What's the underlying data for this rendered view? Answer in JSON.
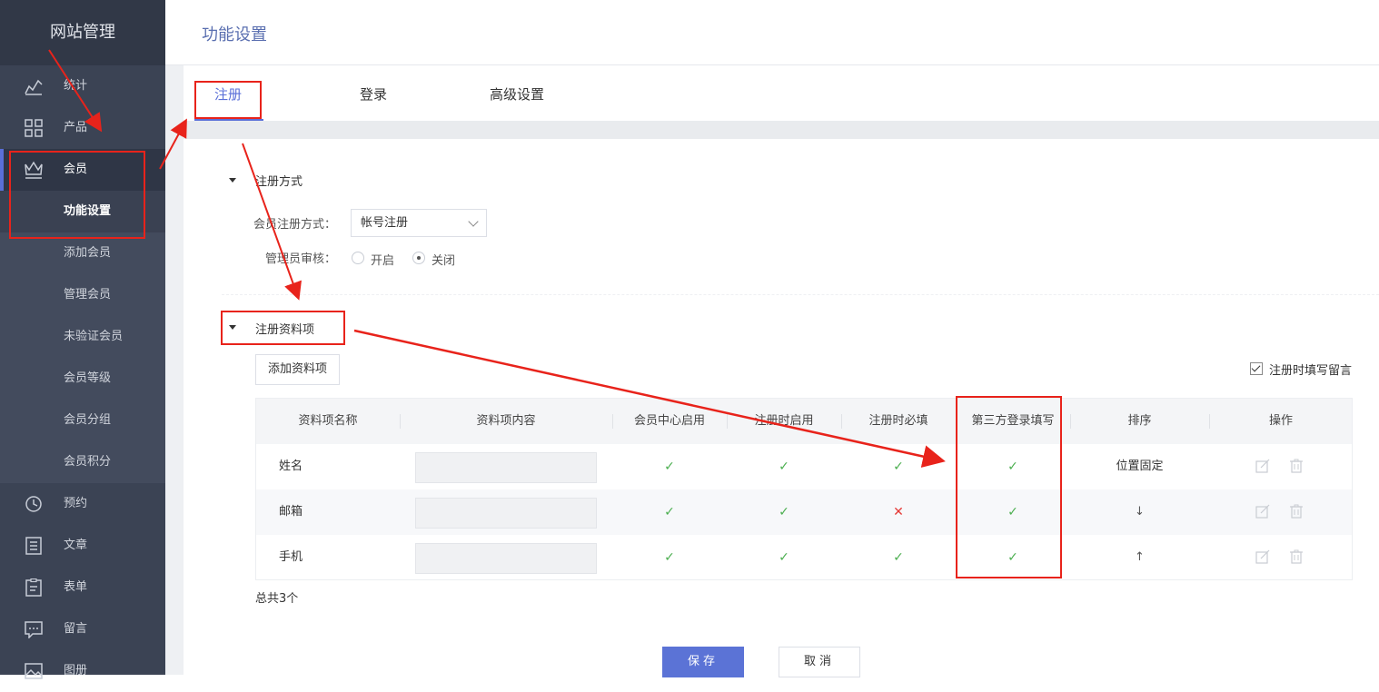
{
  "sidebar": {
    "brand": "网站管理",
    "items": [
      {
        "label": "统计",
        "icon": "stats-icon"
      },
      {
        "label": "产品",
        "icon": "grid-icon"
      },
      {
        "label": "会员",
        "icon": "crown-icon"
      }
    ],
    "submenu": [
      {
        "label": "功能设置"
      },
      {
        "label": "添加会员"
      },
      {
        "label": "管理会员"
      },
      {
        "label": "未验证会员"
      },
      {
        "label": "会员等级"
      },
      {
        "label": "会员分组"
      },
      {
        "label": "会员积分"
      }
    ],
    "items_after": [
      {
        "label": "预约",
        "icon": "clock-icon"
      },
      {
        "label": "文章",
        "icon": "list-icon"
      },
      {
        "label": "表单",
        "icon": "clipboard-icon"
      },
      {
        "label": "留言",
        "icon": "message-icon"
      },
      {
        "label": "图册",
        "icon": "image-icon"
      }
    ]
  },
  "header": {
    "title": "功能设置"
  },
  "tabs": [
    {
      "label": "注册"
    },
    {
      "label": "登录"
    },
    {
      "label": "高级设置"
    }
  ],
  "register_method": {
    "section_title": "注册方式",
    "method_label": "会员注册方式：",
    "method_value": "帐号注册",
    "review_label": "管理员审核：",
    "review_options": [
      {
        "label": "开启"
      },
      {
        "label": "关闭"
      }
    ],
    "review_selected": "关闭"
  },
  "register_fields": {
    "section_title": "注册资料项",
    "add_button": "添加资料项",
    "leave_message_label": "注册时填写留言",
    "leave_message_checked": true,
    "columns": [
      "资料项名称",
      "资料项内容",
      "会员中心启用",
      "注册时启用",
      "注册时必填",
      "第三方登录填写",
      "排序",
      "操作"
    ],
    "rows": [
      {
        "name": "姓名",
        "member_center": "✓",
        "on_register": "✓",
        "required": "✓",
        "third_party": "✓",
        "sort": "位置固定"
      },
      {
        "name": "邮箱",
        "member_center": "✓",
        "on_register": "✓",
        "required": "✕",
        "third_party": "✓",
        "sort": "↓"
      },
      {
        "name": "手机",
        "member_center": "✓",
        "on_register": "✓",
        "required": "✓",
        "third_party": "✓",
        "sort": "↑"
      }
    ],
    "total": "总共3个"
  },
  "footer": {
    "save": "保存",
    "cancel": "取消"
  },
  "colors": {
    "accent": "#5a6fd8",
    "sidebar_bg": "#3b4354",
    "annotation": "#e8231b",
    "check": "#4caf50",
    "cross": "#e53935"
  }
}
